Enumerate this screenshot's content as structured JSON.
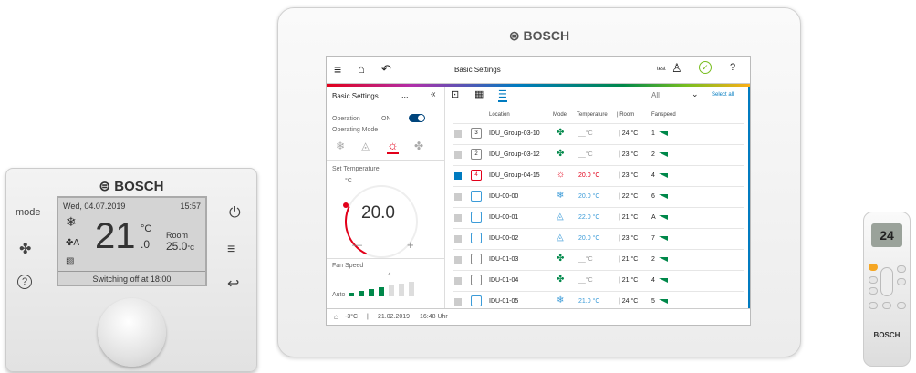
{
  "thermostat": {
    "brand": "BOSCH",
    "date": "Wed, 04.07.2019",
    "time": "15:57",
    "mode_label": "mode",
    "temp_main": "21",
    "temp_unit": "°C",
    "temp_decimal": ".0",
    "room_label": "Room",
    "room_temp": "25.0",
    "room_unit": "°C",
    "fan_auto": "A",
    "status": "Switching off at 18:00"
  },
  "tablet": {
    "brand": "BOSCH",
    "header_title": "Basic Settings",
    "user": "test",
    "help": "?",
    "left": {
      "title": "Basic Settings",
      "more": "...",
      "collapse": "«",
      "operation_label": "Operation",
      "operation_state": "ON",
      "operating_mode_label": "Operating Mode",
      "set_temp_label": "Set Temperature",
      "temp_unit": "°C",
      "set_temp": "20.0",
      "minus": "—",
      "plus": "+",
      "fan_speed_label": "Fan Speed",
      "fan_auto": "Auto",
      "fan_level": "4"
    },
    "filter": "All",
    "select_all": "Select all",
    "columns": [
      "Location",
      "Mode",
      "Temperature",
      "| Room",
      "Fanspeed"
    ],
    "rows": [
      {
        "badge": "3",
        "name": "IDU_Group-03-10",
        "mode": "fan",
        "temp": "__°C",
        "room": "| 24 °C",
        "fan": "1",
        "checked": false
      },
      {
        "badge": "2",
        "name": "IDU_Group-03-12",
        "mode": "fan",
        "temp": "__°C",
        "room": "| 23 °C",
        "fan": "2",
        "checked": false
      },
      {
        "badge": "4",
        "name": "IDU_Group-04-15",
        "mode": "heat",
        "temp": "20.0 °C",
        "room": "| 23 °C",
        "fan": "4",
        "checked": true
      },
      {
        "badge": "",
        "name": "IDU-00-00",
        "mode": "cool",
        "temp": "20.0 °C",
        "room": "| 22 °C",
        "fan": "6",
        "checked": false
      },
      {
        "badge": "",
        "name": "IDU-00-01",
        "mode": "dry",
        "temp": "22.0 °C",
        "room": "| 21 °C",
        "fan": "A",
        "checked": false
      },
      {
        "badge": "",
        "name": "IDU-00-02",
        "mode": "dry",
        "temp": "20.0 °C",
        "room": "| 23 °C",
        "fan": "7",
        "checked": false
      },
      {
        "badge": "",
        "name": "IDU-01-03",
        "mode": "fan",
        "temp": "__°C",
        "room": "| 21 °C",
        "fan": "2",
        "checked": false
      },
      {
        "badge": "",
        "name": "IDU-01-04",
        "mode": "fan",
        "temp": "__°C",
        "room": "| 21 °C",
        "fan": "4",
        "checked": false
      },
      {
        "badge": "",
        "name": "IDU-01-05",
        "mode": "cool",
        "temp": "21.0 °C",
        "room": "| 24 °C",
        "fan": "5",
        "checked": false
      }
    ],
    "footer_temp": "-3°C",
    "footer_date": "21.02.2019",
    "footer_time": "16:48 Uhr"
  },
  "remote": {
    "display": "24",
    "brand": "BOSCH"
  },
  "colors": {
    "accent": "#007bc0",
    "heat": "#e2001a",
    "cool": "#3b9bd8",
    "fan": "#00884a"
  }
}
